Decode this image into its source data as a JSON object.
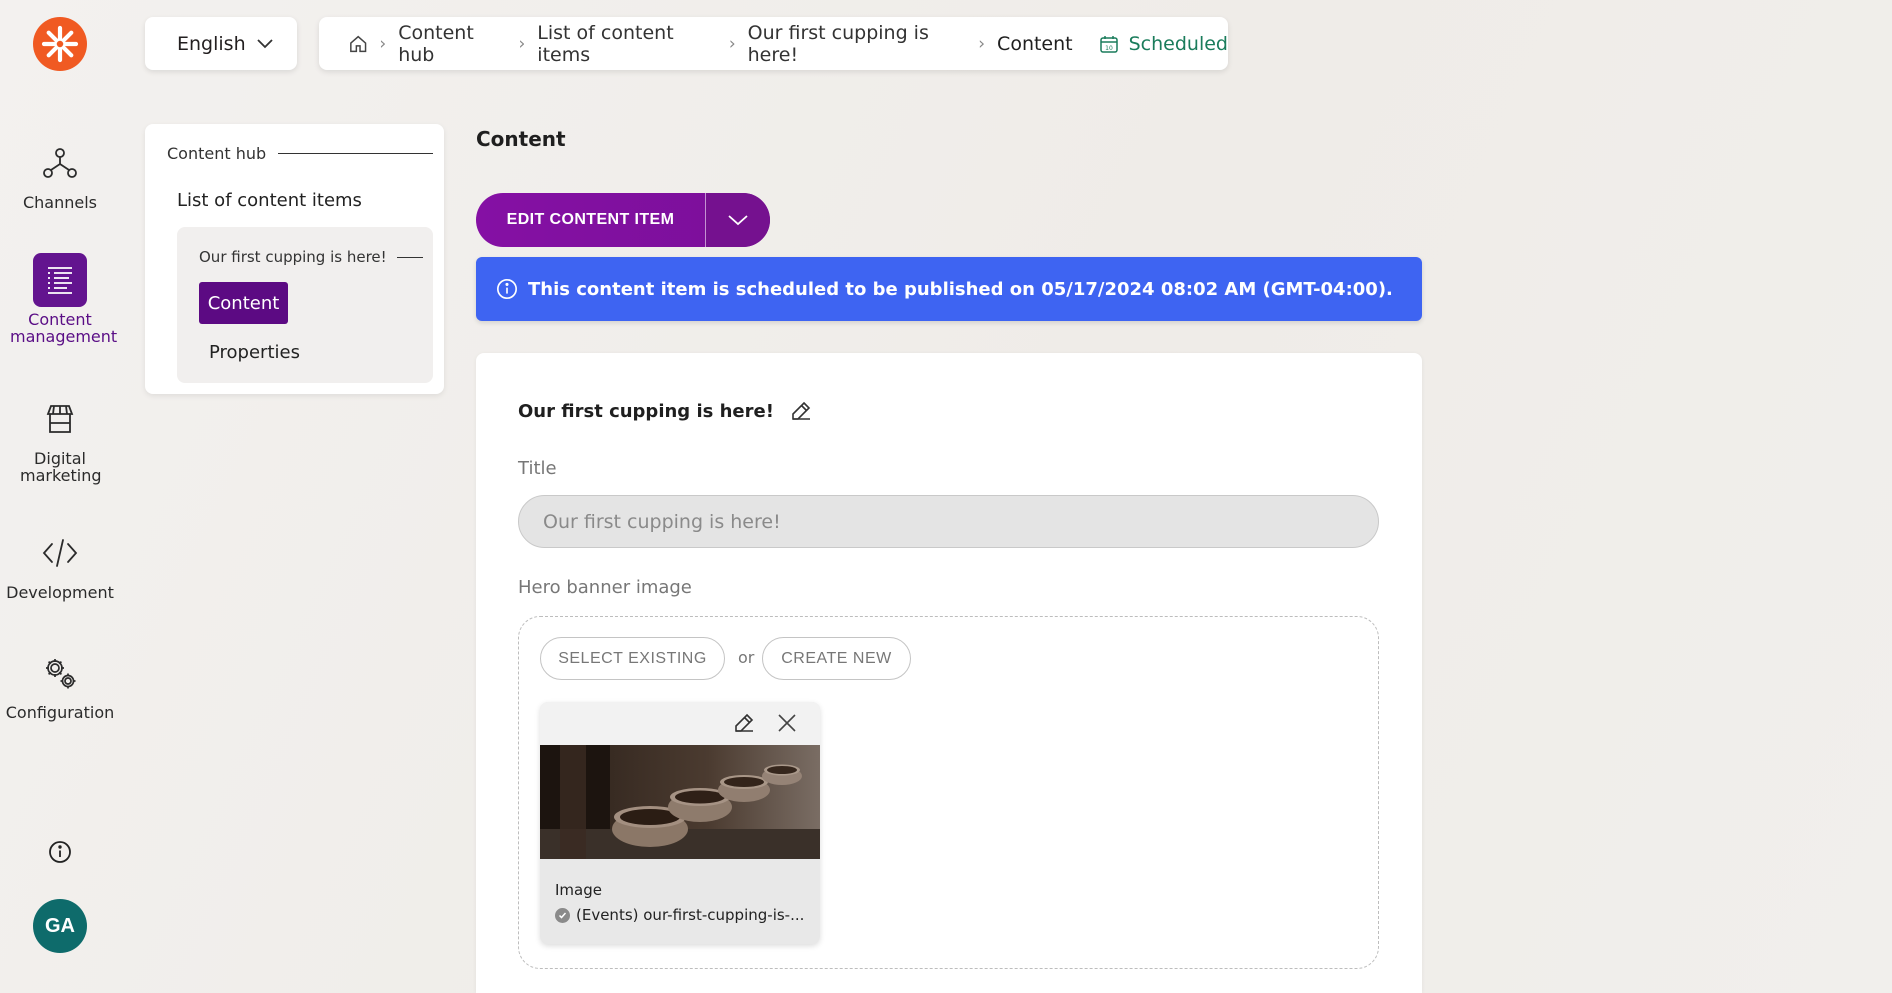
{
  "rail": {
    "items": [
      {
        "label": "Channels"
      },
      {
        "label": "Content management"
      },
      {
        "label": "Digital marketing"
      },
      {
        "label": "Development"
      },
      {
        "label": "Configuration"
      }
    ],
    "avatar": "GA"
  },
  "language": {
    "selected": "English"
  },
  "breadcrumb": {
    "items": [
      "Content hub",
      "List of content items",
      "Our first cupping is here!",
      "Content"
    ],
    "status": "Scheduled",
    "status_color": "#1a7c5b"
  },
  "tree": {
    "hub": "Content hub",
    "list": "List of content items",
    "item": "Our first cupping is here!",
    "content": "Content",
    "properties": "Properties"
  },
  "main": {
    "title": "Content",
    "edit_button": "EDIT CONTENT ITEM",
    "banner": "This content item is scheduled to be published on 05/17/2024 08:02 AM (GMT-04:00).",
    "banner_color": "#3e64f2",
    "card_title": "Our first cupping is here!",
    "title_label": "Title",
    "title_value": "Our first cupping is here!",
    "hero_label": "Hero banner image",
    "select_existing": "SELECT EXISTING",
    "or": "or",
    "create_new": "CREATE NEW",
    "asset_type": "Image",
    "asset_name": "(Events) our-first-cupping-is-..."
  },
  "colors": {
    "accent": "#63148f",
    "brand": "#f05a22"
  }
}
